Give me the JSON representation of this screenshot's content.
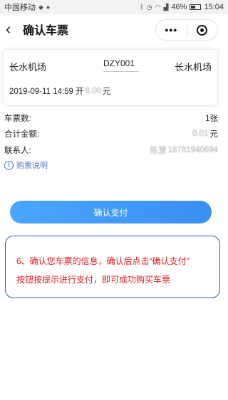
{
  "status_bar": {
    "carrier": "中国移动",
    "battery": "46%",
    "battery_level": 0.46,
    "time": "15:04"
  },
  "nav": {
    "back_icon": "chevron-left-icon",
    "title": "确认车票",
    "more_label": "•••"
  },
  "ticket": {
    "from": "长水机场",
    "to": "长水机场",
    "number": "DZY001",
    "departure": "2019-09-11 14:59 开",
    "price": "8.00",
    "price_unit": "元"
  },
  "summary": {
    "count_label": "车票数:",
    "count_value": "1张",
    "total_label": "合计金额:",
    "total_value": "0.01",
    "total_unit": "元",
    "contact_label": "联系人:",
    "contact_name": "陈慧",
    "contact_phone": "18781940694"
  },
  "help": {
    "icon": "info-icon",
    "label": "购票说明"
  },
  "pay_button": {
    "label": "确认支付"
  },
  "instruction": {
    "line1": "6、确认您车票的信息，确认后点击“确认支付”",
    "line2": "按钮按提示进行支付，即可成功购买车票"
  },
  "colors": {
    "accent": "#3a8ff0",
    "link": "#4a78b8",
    "note_text": "#e01a1a",
    "note_border": "#2e5bb8"
  }
}
